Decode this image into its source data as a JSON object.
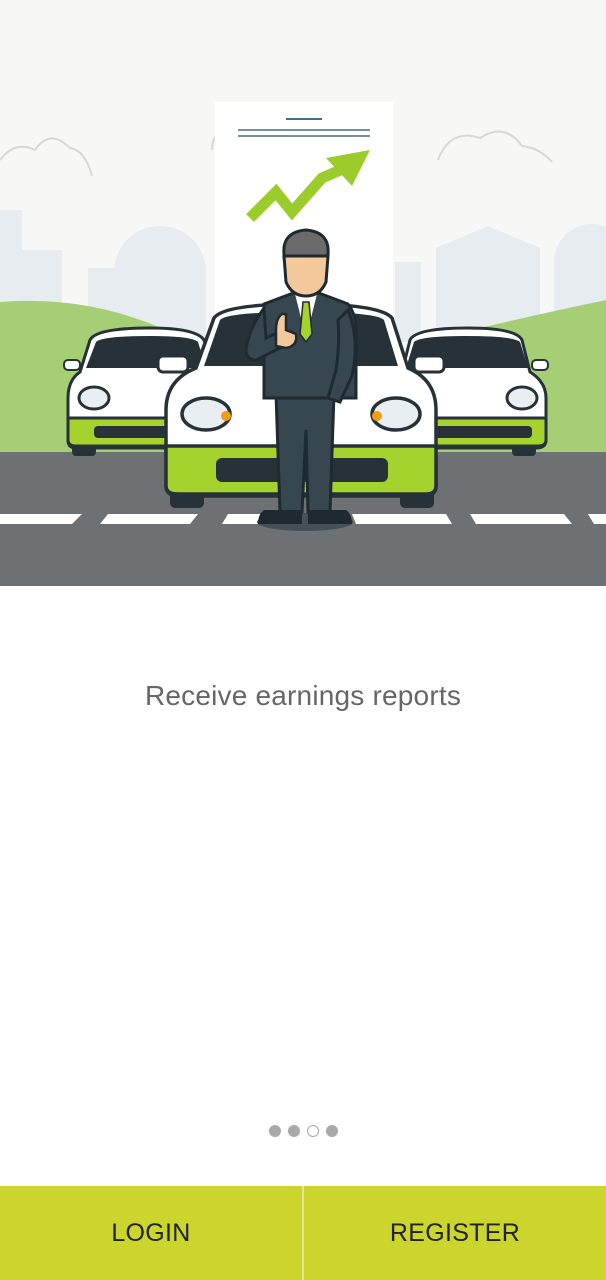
{
  "onboarding": {
    "caption": "Receive earnings reports",
    "pager": {
      "count": 4,
      "active_index": 2
    }
  },
  "actions": {
    "login_label": "LOGIN",
    "register_label": "REGISTER"
  },
  "colors": {
    "accent": "#cbd52d",
    "car_accent": "#a6d22e",
    "road": "#6e7173",
    "caption_text": "#666666"
  }
}
